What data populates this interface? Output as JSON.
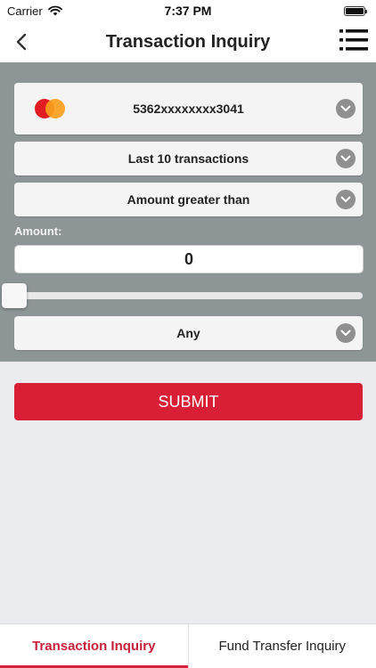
{
  "status_bar": {
    "carrier": "Carrier",
    "time": "7:37 PM"
  },
  "header": {
    "title": "Transaction Inquiry"
  },
  "form": {
    "card": {
      "value": "5362xxxxxxxx3041",
      "brand_icon": "mastercard-logo"
    },
    "period": {
      "value": "Last 10 transactions"
    },
    "filter": {
      "value": "Amount greater than"
    },
    "amount_label": "Amount:",
    "amount_value": "0",
    "slider_fraction": 0,
    "type": {
      "value": "Any"
    }
  },
  "submit_label": "SUBMIT",
  "tabs": [
    {
      "label": "Transaction Inquiry",
      "active": true
    },
    {
      "label": "Fund Transfer Inquiry",
      "active": false
    }
  ],
  "colors": {
    "accent": "#d81f35",
    "panel": "#8e9597",
    "background": "#e9ebef"
  }
}
